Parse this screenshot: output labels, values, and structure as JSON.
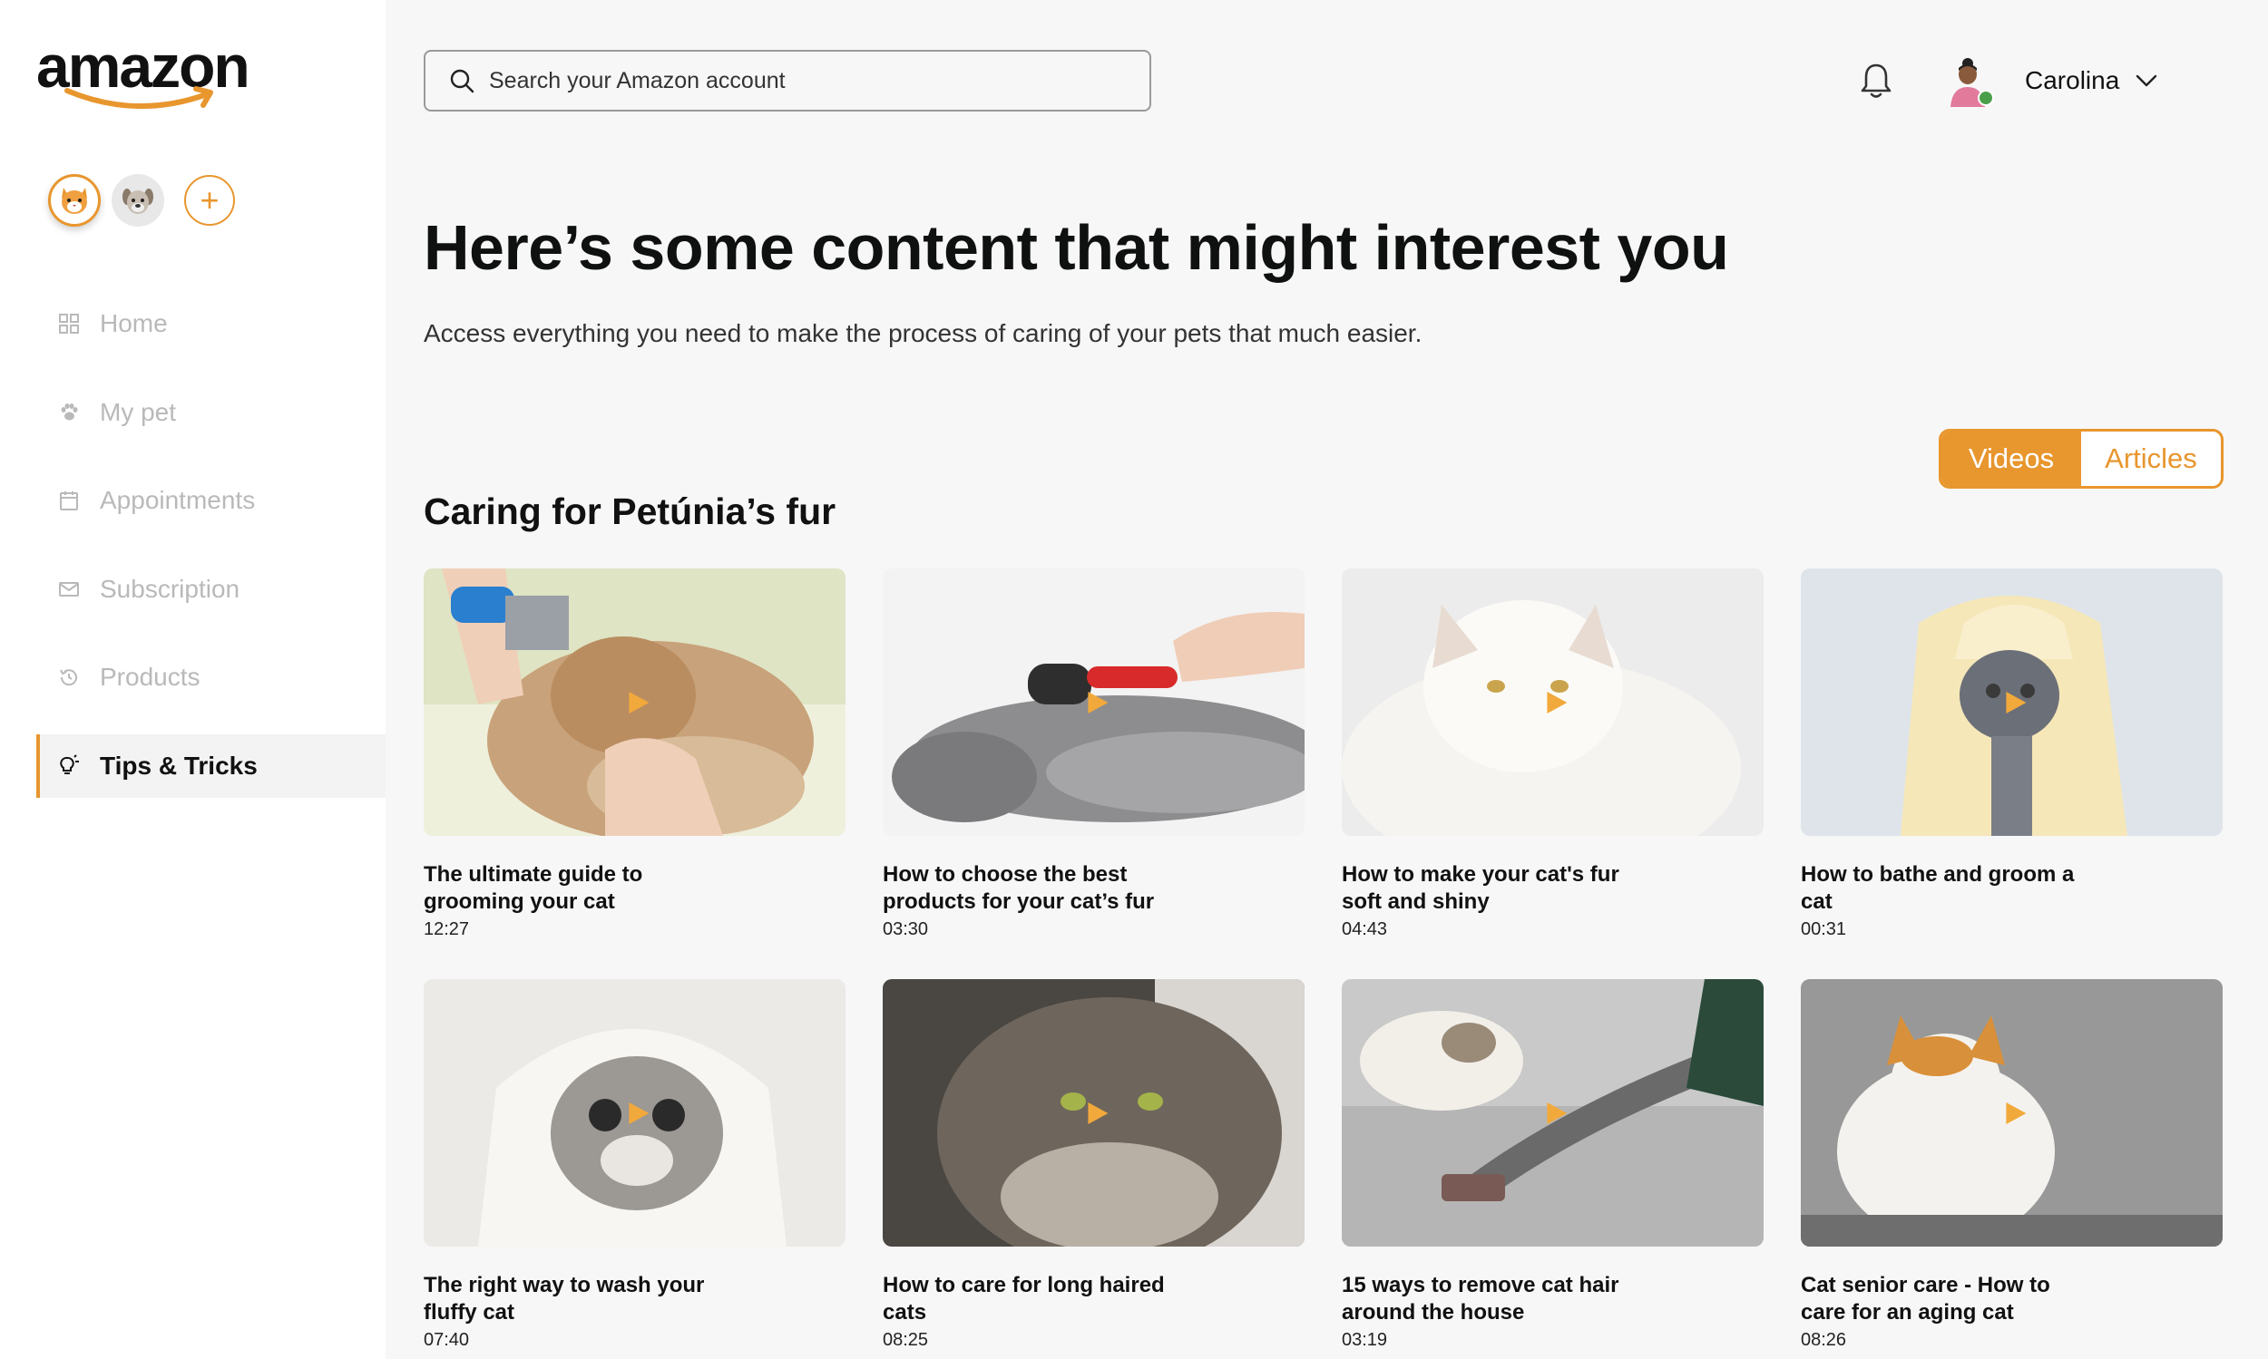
{
  "brand": {
    "logo_text": "amazon",
    "accent": "#e8962e"
  },
  "sidebar": {
    "pets": [
      {
        "name": "cat-avatar",
        "active": true
      },
      {
        "name": "dog-avatar",
        "active": false
      }
    ],
    "add_pet_label": "+",
    "items": [
      {
        "label": "Home",
        "icon": "grid-icon",
        "active": false
      },
      {
        "label": "My pet",
        "icon": "paw-icon",
        "active": false
      },
      {
        "label": "Appointments",
        "icon": "calendar-icon",
        "active": false
      },
      {
        "label": "Subscription",
        "icon": "mail-icon",
        "active": false
      },
      {
        "label": "Products",
        "icon": "history-icon",
        "active": false
      },
      {
        "label": "Tips & Tricks",
        "icon": "lightbulb-icon",
        "active": true
      }
    ]
  },
  "header": {
    "search_placeholder": "Search your Amazon account",
    "user_name": "Carolina"
  },
  "main": {
    "headline": "Here’s some content that might interest you",
    "subtext": "Access everything you need to make the process of caring of your pets that much easier.",
    "toggle": {
      "videos": "Videos",
      "articles": "Articles",
      "selected": "Videos"
    },
    "section_title": "Caring for Petúnia’s fur",
    "videos": [
      {
        "title": "The ultimate guide to grooming your cat",
        "duration": "12:27"
      },
      {
        "title": "How to choose the best products for your cat’s fur",
        "duration": "03:30"
      },
      {
        "title": "How to make your cat's fur soft and shiny",
        "duration": "04:43"
      },
      {
        "title": "How to bathe and groom a cat",
        "duration": "00:31"
      },
      {
        "title": "The right way to wash your fluffy cat",
        "duration": "07:40"
      },
      {
        "title": "How to care for long haired cats",
        "duration": "08:25"
      },
      {
        "title": "15 ways to remove cat hair around the house",
        "duration": "03:19"
      },
      {
        "title": "Cat senior care - How to care for an aging cat",
        "duration": "08:26"
      }
    ]
  }
}
